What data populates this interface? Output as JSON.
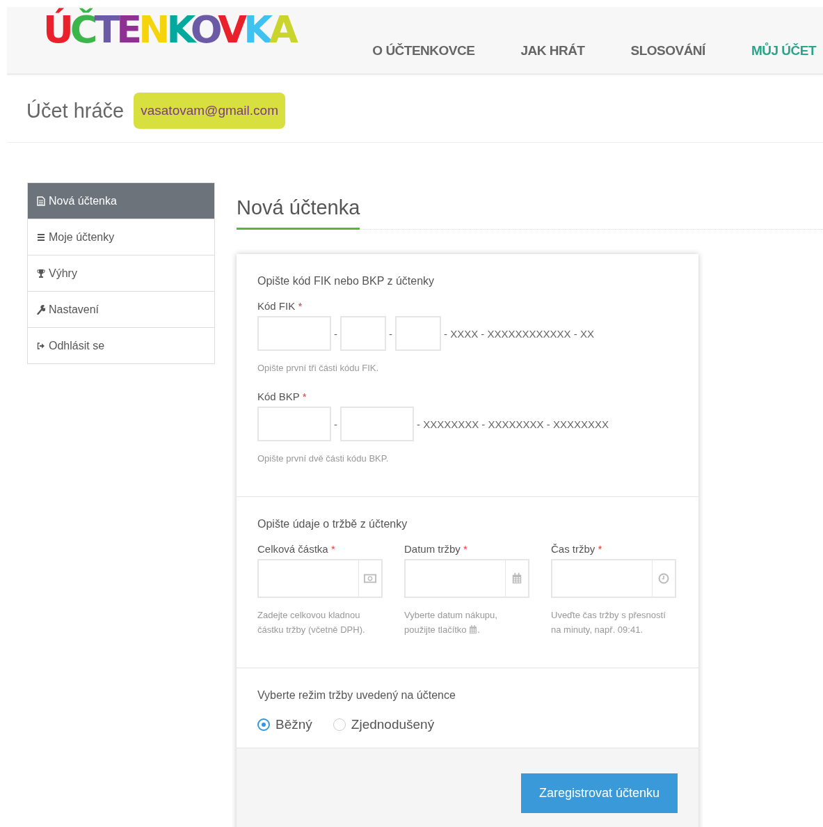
{
  "header": {
    "logo": "ÚČTENKOVKA",
    "nav": [
      {
        "label": "O ÚČTENKOVCE",
        "selected": false
      },
      {
        "label": "JAK HRÁT",
        "selected": false
      },
      {
        "label": "SLOSOVÁNÍ",
        "selected": false
      },
      {
        "label": "MŮJ ÚČET",
        "selected": true
      }
    ]
  },
  "account": {
    "title": "Účet hráče",
    "email": "vasatovam@gmail.com"
  },
  "sidebar": {
    "items": [
      {
        "label": "Nová účtenka",
        "selected": true
      },
      {
        "label": "Moje účtenky",
        "selected": false
      },
      {
        "label": "Výhry",
        "selected": false
      },
      {
        "label": "Nastavení",
        "selected": false
      },
      {
        "label": "Odhlásit se",
        "selected": false
      }
    ]
  },
  "main": {
    "heading": "Nová účtenka",
    "code_section": {
      "title": "Opište kód FIK nebo BKP z účtenky",
      "fields": [
        {
          "label": "Kód FIK",
          "required_mark": "*",
          "parts": [
            {
              "kind": "wide"
            },
            {
              "kind": "narrow"
            },
            {
              "kind": "narrow"
            }
          ],
          "separator": "-",
          "suffix": "- XXXX - XXXXXXXXXXXX - XX",
          "help": "Opište první tři části kódu FIK."
        },
        {
          "label": "Kód BKP",
          "required_mark": "*",
          "parts": [
            {
              "kind": "wide"
            },
            {
              "kind": "wide"
            }
          ],
          "separator": "-",
          "suffix": "- XXXXXXXX - XXXXXXXX - XXXXXXXX",
          "help": "Opište první dvě části kódu BKP."
        }
      ]
    },
    "sale_section": {
      "title": "Opište údaje o tržbě z účtenky",
      "fields": [
        {
          "label": "Celková částka",
          "required_mark": "*",
          "kind": "amount",
          "help": [
            {
              "kind": "text",
              "text": "Zadejte celkovou kladnou částku tržby (včetně DPH)."
            }
          ]
        },
        {
          "label": "Datum tržby",
          "required_mark": "*",
          "kind": "date",
          "help": [
            {
              "kind": "text",
              "text": "Vyberte datum nákupu, použijte tlačítko"
            },
            {
              "kind": "icon"
            },
            {
              "kind": "text",
              "text": "."
            }
          ]
        },
        {
          "label": "Čas tržby",
          "required_mark": "*",
          "kind": "time",
          "help": [
            {
              "kind": "text",
              "text": "Uveďte čas tržby s přesností na minuty, např. 09:41."
            }
          ]
        }
      ]
    },
    "mode_section": {
      "title": "Vyberte režim tržby uvedený na účtence",
      "options": [
        {
          "label": "Běžný",
          "selected": true
        },
        {
          "label": "Zjednodušený",
          "selected": false
        }
      ]
    },
    "submit": "Zaregistrovat účtenku"
  }
}
